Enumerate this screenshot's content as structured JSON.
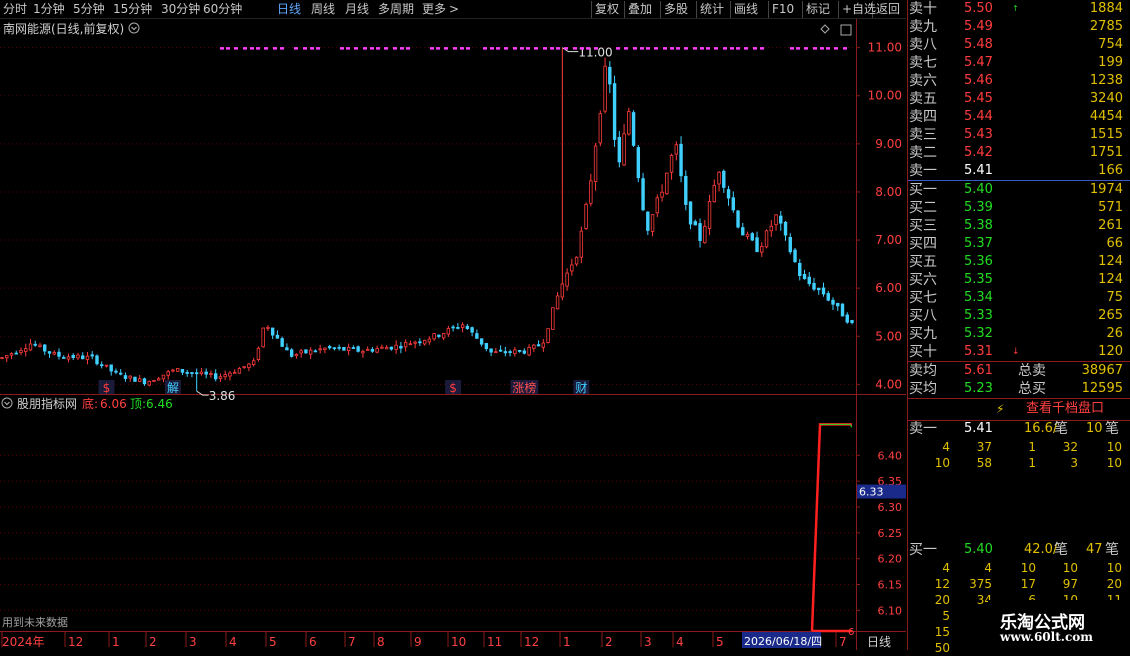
{
  "toolbar": {
    "periods": [
      "分时",
      "1分钟",
      "5分钟",
      "15分钟",
      "30分钟",
      "60分钟",
      "日线",
      "周线",
      "月线",
      "多周期",
      "更多"
    ],
    "selected": "日线",
    "more_arrow": ">",
    "actions": [
      "复权",
      "叠加",
      "多股",
      "统计",
      "画线",
      "F10",
      "标记",
      "+自选",
      "返回"
    ]
  },
  "main_panel": {
    "title": "南网能源(日线,前复权)",
    "y_ticks": [
      "11.00",
      "10.00",
      "9.00",
      "8.00",
      "7.00",
      "6.00",
      "5.00",
      "4.00"
    ],
    "y_range": [
      3.8,
      11.2
    ],
    "high_label": "11.00",
    "low_label": "3.86",
    "high": 11.0,
    "low": 3.86,
    "events": [
      {
        "label": "$",
        "color": "#ff3c3c",
        "index": 22
      },
      {
        "label": "解",
        "color": "#40d0ff",
        "index": 36
      },
      {
        "label": "$",
        "color": "#ff3c3c",
        "index": 95
      },
      {
        "label": "涨榜",
        "color": "#ff5050",
        "index": 110
      },
      {
        "label": "财",
        "color": "#40d0ff",
        "index": 122
      }
    ]
  },
  "indicator_panel": {
    "name": "股朋指标网",
    "bottom_label": "底:",
    "bottom_value": "6.06",
    "top_label": "顶:",
    "top_value": "6.46",
    "y_ticks": [
      "6.40",
      "6.35",
      "6.30",
      "6.25",
      "6.20",
      "6.15",
      "6.10"
    ],
    "y_range": [
      6.06,
      6.48
    ],
    "cursor_value": "6.33",
    "right_marker": "6",
    "note": "用到未来数据"
  },
  "time_axis": {
    "labels": [
      "2024年",
      "12",
      "1",
      "2",
      "3",
      "4",
      "5",
      "6",
      "7",
      "8",
      "9",
      "10",
      "11",
      "12",
      "1",
      "2",
      "3",
      "4",
      "5",
      "6",
      "7"
    ],
    "highlight": "2026/06/18/四",
    "period_tab": "日线"
  },
  "order_book": {
    "asks": [
      {
        "name": "卖十",
        "price": "5.50",
        "vol": "1884",
        "up": true
      },
      {
        "name": "卖九",
        "price": "5.49",
        "vol": "2785"
      },
      {
        "name": "卖八",
        "price": "5.48",
        "vol": "754"
      },
      {
        "name": "卖七",
        "price": "5.47",
        "vol": "199"
      },
      {
        "name": "卖六",
        "price": "5.46",
        "vol": "1238"
      },
      {
        "name": "卖五",
        "price": "5.45",
        "vol": "3240"
      },
      {
        "name": "卖四",
        "price": "5.44",
        "vol": "4454"
      },
      {
        "name": "卖三",
        "price": "5.43",
        "vol": "1515"
      },
      {
        "name": "卖二",
        "price": "5.42",
        "vol": "1751"
      },
      {
        "name": "卖一",
        "price": "5.41",
        "vol": "166"
      }
    ],
    "bids": [
      {
        "name": "买一",
        "price": "5.40",
        "vol": "1974"
      },
      {
        "name": "买二",
        "price": "5.39",
        "vol": "571"
      },
      {
        "name": "买三",
        "price": "5.38",
        "vol": "261"
      },
      {
        "name": "买四",
        "price": "5.37",
        "vol": "66"
      },
      {
        "name": "买五",
        "price": "5.36",
        "vol": "124"
      },
      {
        "name": "买六",
        "price": "5.35",
        "vol": "124"
      },
      {
        "name": "买七",
        "price": "5.34",
        "vol": "75"
      },
      {
        "name": "买八",
        "price": "5.33",
        "vol": "265"
      },
      {
        "name": "买九",
        "price": "5.32",
        "vol": "26"
      },
      {
        "name": "买十",
        "price": "5.31",
        "vol": "120",
        "down": true
      }
    ],
    "avg_sell": {
      "name": "卖均",
      "price": "5.61",
      "label": "总卖",
      "vol": "38967"
    },
    "avg_buy": {
      "name": "买均",
      "price": "5.23",
      "label": "总买",
      "vol": "12595"
    },
    "view_button": "查看千档盘口",
    "ask1": {
      "name": "卖一",
      "price": "5.41",
      "per": "16.6/",
      "unit": "笔",
      "count": "10",
      "unit2": "笔"
    },
    "ask1_rows": [
      [
        "4",
        "37",
        "1",
        "32",
        "10"
      ],
      [
        "10",
        "58",
        "1",
        "3",
        "10"
      ]
    ],
    "bid1": {
      "name": "买一",
      "price": "5.40",
      "per": "42.0/",
      "unit": "笔",
      "count": "47",
      "unit2": "笔"
    },
    "bid1_rows": [
      [
        "4",
        "4",
        "10",
        "10",
        "10"
      ],
      [
        "12",
        "375",
        "17",
        "97",
        "20"
      ],
      [
        "20",
        "34",
        "6",
        "10",
        "11"
      ],
      [
        "5",
        "",
        "",
        "",
        ""
      ],
      [
        "15",
        "",
        "",
        "",
        ""
      ],
      [
        "50",
        "",
        "",
        "",
        ""
      ]
    ]
  },
  "watermark": {
    "title": "乐淘公式网",
    "url": "www.60lt.com"
  },
  "colors": {
    "up": "#ff3c3c",
    "down": "#40d0ff",
    "grid": "#5a0000",
    "axis": "#8b1a1a",
    "magenta": "#ff40ff",
    "indicator_line": "#ff2020",
    "indicator_top": "#22dd22"
  }
}
